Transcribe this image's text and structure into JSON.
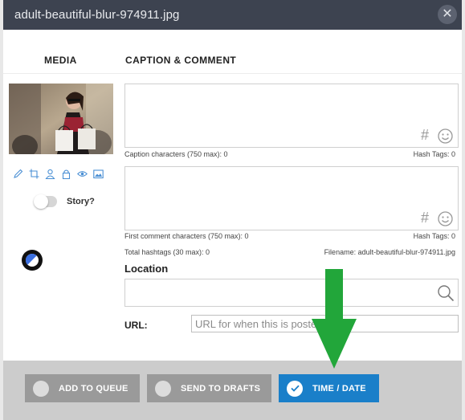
{
  "window": {
    "title": "adult-beautiful-blur-974911.jpg",
    "close_icon": "close-icon"
  },
  "columns": {
    "media": "MEDIA",
    "caption_comment": "CAPTION & COMMENT"
  },
  "media": {
    "thumbnail": "photo-thumbnail",
    "tools": [
      "pencil-icon",
      "crop-icon",
      "user-tag-icon",
      "lock-icon",
      "eye-icon",
      "image-icon"
    ],
    "story_label": "Story?",
    "story_enabled": false
  },
  "caption": {
    "counter": "Caption characters (750 max): 0",
    "hashtags": "Hash Tags: 0",
    "value": ""
  },
  "comment": {
    "counter": "First comment characters (750 max): 0",
    "hashtags": "Hash Tags: 0",
    "value": ""
  },
  "totals": {
    "hashtags": "Total hashtags (30 max): 0",
    "filename": "Filename: adult-beautiful-blur-974911.jpg"
  },
  "location": {
    "label": "Location",
    "value": ""
  },
  "url": {
    "label": "URL:",
    "placeholder": "URL for when this is posted"
  },
  "buttons": {
    "add_to_queue": "ADD TO QUEUE",
    "send_to_drafts": "SEND TO DRAFTS",
    "time_date": "TIME / DATE"
  },
  "colors": {
    "titlebar": "#3d4350",
    "primary": "#1a7fc9",
    "secondary_button": "#9a9a9a",
    "footer": "#cccccc",
    "arrow": "#22a63a"
  }
}
